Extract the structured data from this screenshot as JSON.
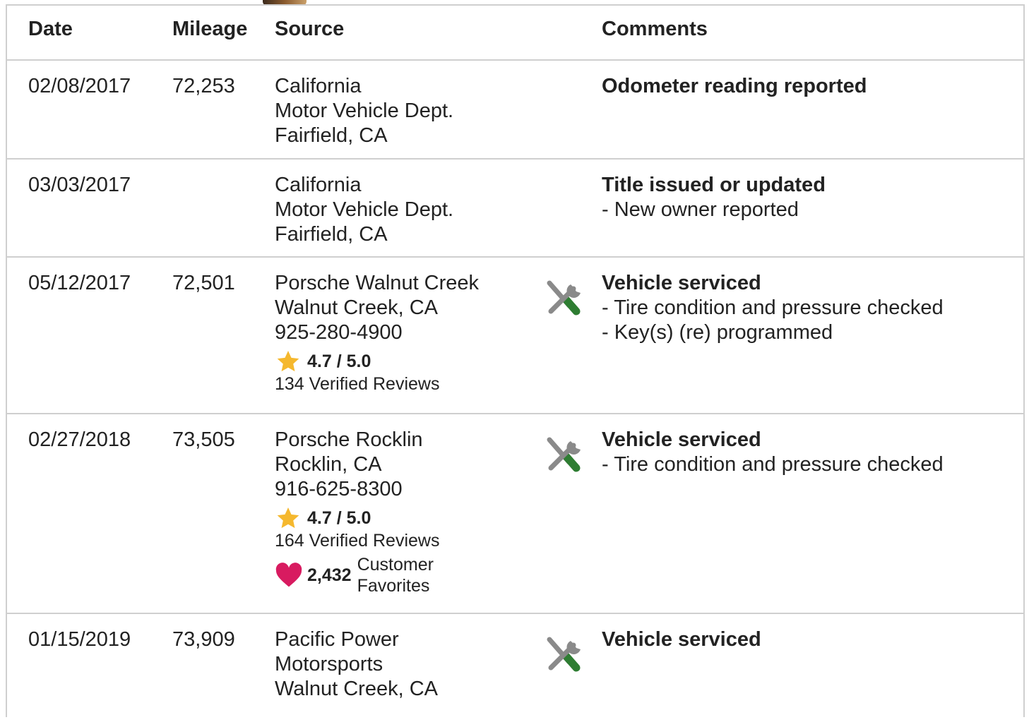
{
  "header": {
    "date": "Date",
    "mileage": "Mileage",
    "source": "Source",
    "comments": "Comments"
  },
  "rows": [
    {
      "date": "02/08/2017",
      "mileage": "72,253",
      "source": [
        "California",
        "Motor Vehicle Dept.",
        "Fairfield, CA"
      ],
      "comment_title": "Odometer reading reported",
      "comment_items": []
    },
    {
      "date": "03/03/2017",
      "mileage": "",
      "source": [
        "California",
        "Motor Vehicle Dept.",
        "Fairfield, CA"
      ],
      "comment_title": "Title issued or updated",
      "comment_items": [
        "- New owner reported"
      ]
    },
    {
      "date": "05/12/2017",
      "mileage": "72,501",
      "source": [
        "Porsche Walnut Creek",
        "Walnut Creek, CA",
        "925-280-4900"
      ],
      "rating": "4.7 / 5.0",
      "reviews": "134 Verified Reviews",
      "icon": "service-tools-icon",
      "comment_title": "Vehicle serviced",
      "comment_items": [
        "- Tire condition and pressure checked",
        "- Key(s) (re) programmed"
      ]
    },
    {
      "date": "02/27/2018",
      "mileage": "73,505",
      "source": [
        "Porsche Rocklin",
        "Rocklin, CA",
        "916-625-8300"
      ],
      "rating": "4.7 / 5.0",
      "reviews": "164 Verified Reviews",
      "favorites_count": "2,432",
      "favorites_label": [
        "Customer",
        "Favorites"
      ],
      "icon": "service-tools-icon",
      "comment_title": "Vehicle serviced",
      "comment_items": [
        "- Tire condition and pressure checked"
      ]
    },
    {
      "date": "01/15/2019",
      "mileage": "73,909",
      "source": [
        "Pacific Power",
        "Motorsports",
        "Walnut Creek, CA"
      ],
      "icon": "service-tools-icon",
      "comment_title": "Vehicle serviced",
      "comment_items": []
    }
  ],
  "colors": {
    "star": "#f5b82e",
    "heart": "#d81b60",
    "wrench_green": "#2e7d32",
    "tool_gray": "#8a8a8a",
    "border": "#cfcfcf"
  }
}
